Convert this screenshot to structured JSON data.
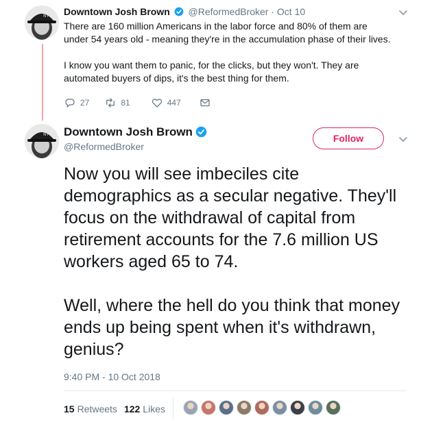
{
  "tweet1": {
    "name": "Downtown Josh Brown",
    "handle": "@ReformedBroker",
    "separator": "·",
    "date": "Oct 10",
    "paragraph1": "There are 160 million Americans in the labor force and 80% of them are under 54 years old - meaning they're in the accumulation phase of their lives.",
    "paragraph2": "I know you want them to panic, for the clicks, but they won't. They are automated buyers of dips, it's the best thing for them.",
    "replies": "27",
    "retweets": "81",
    "likes": "447"
  },
  "tweet2": {
    "name": "Downtown Josh Brown",
    "handle": "@ReformedBroker",
    "follow_label": "Follow",
    "paragraph1": "Now you will see imbeciles cite demographics as a secular negative. They'll focus on the withdrawal of capital from retirement accounts for the 7.6 million US workers aged 65 to 74.",
    "paragraph2": "Well, where the hell do you think that money ends up being spent when it's withdrawn, genius?",
    "timestamp": "9:40 PM - 10 Oct 2018",
    "retweet_count": "15",
    "retweet_label": "Retweets",
    "like_count": "122",
    "like_label": "Likes",
    "liker_colors": [
      "#9aa5b1",
      "#c9746b",
      "#5b6f8a",
      "#8a7a66",
      "#b06a5c",
      "#7d8fa3",
      "#3b3f48",
      "#6f8c9c",
      "#59705a"
    ]
  },
  "colors": {
    "accent": "#e0245e",
    "verified": "#1da1f2",
    "thread_line": "#f4a3a8",
    "muted": "#657786"
  },
  "icons": [
    "verified-badge-icon",
    "chevron-down-icon",
    "reply-icon",
    "retweet-icon",
    "heart-icon",
    "envelope-icon"
  ]
}
